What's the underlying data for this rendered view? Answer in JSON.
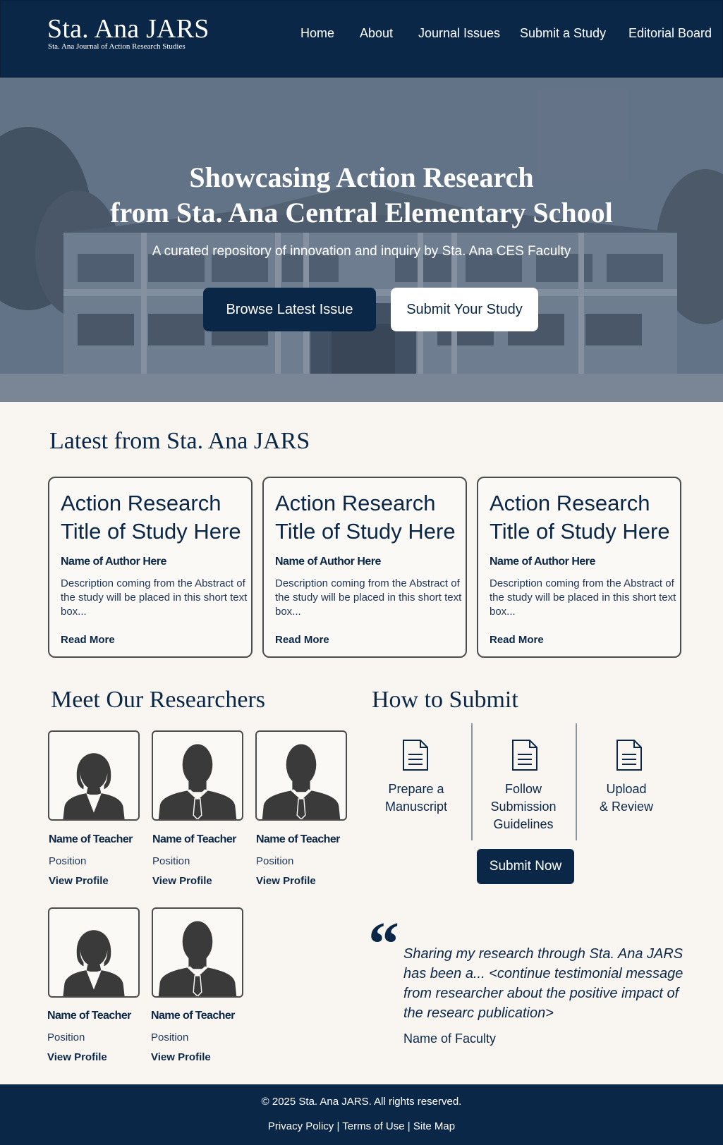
{
  "header": {
    "logo_title": "Sta. Ana JARS",
    "logo_subtitle": "Sta. Ana Journal of Action Research Studies",
    "nav": [
      "Home",
      "About",
      "Journal Issues",
      "Submit a Study",
      "Editorial Board"
    ]
  },
  "hero": {
    "title_line1": "Showcasing Action Research",
    "title_line2": "from Sta. Ana Central Elementary School",
    "subtitle": "A curated repository of innovation and inquiry by Sta. Ana CES Faculty",
    "primary_button": "Browse Latest Issue",
    "secondary_button": "Submit Your Study"
  },
  "latest": {
    "heading": "Latest from Sta. Ana JARS",
    "cards": [
      {
        "title": "Action Research Title of Study Here",
        "author": "Name of Author Here",
        "description": "Description coming from the Abstract of the study will be placed in this short text box...",
        "link": "Read More"
      },
      {
        "title": "Action Research Title of Study Here",
        "author": "Name of Author Here",
        "description": "Description coming from the Abstract of the study will be placed in this short text box...",
        "link": "Read More"
      },
      {
        "title": "Action Research Title of Study Here",
        "author": "Name of Author Here",
        "description": "Description coming from the Abstract of the study will be placed in this short text box...",
        "link": "Read More"
      }
    ]
  },
  "researchers": {
    "heading": "Meet Our Researchers",
    "people": [
      {
        "name": "Name of Teacher",
        "position": "Position",
        "link": "View Profile",
        "avatar": "female-avatar-icon"
      },
      {
        "name": "Name of Teacher",
        "position": "Position",
        "link": "View Profile",
        "avatar": "male-avatar-icon"
      },
      {
        "name": "Name of Teacher",
        "position": "Position",
        "link": "View Profile",
        "avatar": "male-avatar-icon"
      },
      {
        "name": "Name of Teacher",
        "position": "Position",
        "link": "View Profile",
        "avatar": "female-avatar-icon"
      },
      {
        "name": "Name of Teacher",
        "position": "Position",
        "link": "View Profile",
        "avatar": "male-avatar-icon"
      }
    ]
  },
  "submit": {
    "heading": "How to Submit",
    "steps": [
      {
        "line1": "Prepare a",
        "line2": "Manuscript",
        "line3": ""
      },
      {
        "line1": "Follow",
        "line2": "Submission",
        "line3": "Guidelines"
      },
      {
        "line1": "Upload",
        "line2": "& Review",
        "line3": ""
      }
    ],
    "button": "Submit Now"
  },
  "testimonial": {
    "quote_mark": "“",
    "text": "Sharing my research through Sta. Ana JARS has been a... <continue testimonial message from researcher about the positive impact of the researc publication>",
    "name": "Name of Faculty"
  },
  "footer": {
    "copyright": "© 2025 Sta. Ana JARS. All rights reserved.",
    "links": [
      "Privacy Policy",
      "Terms of Use",
      "Site Map"
    ]
  },
  "colors": {
    "navy": "#0b2748",
    "cream": "#f9f6f1"
  }
}
